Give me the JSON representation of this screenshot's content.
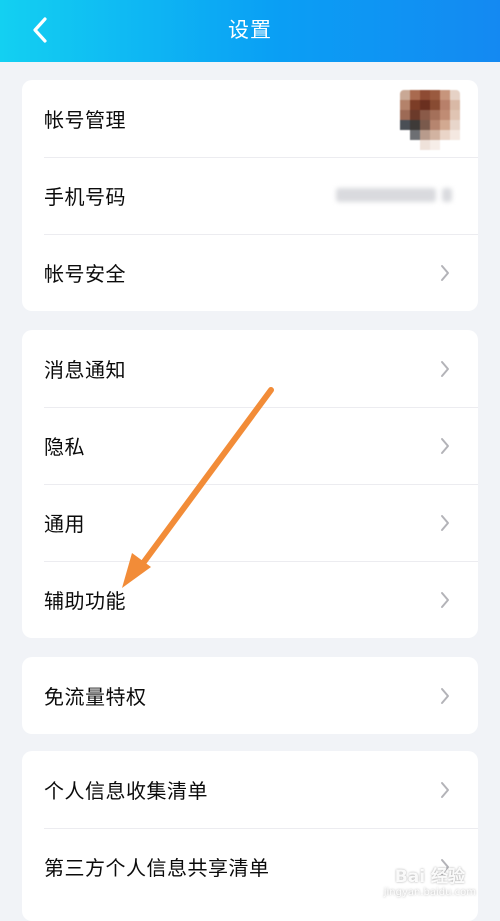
{
  "header": {
    "title": "设置",
    "back_icon": "chevron-left-icon"
  },
  "groups": [
    {
      "items": [
        {
          "label": "帐号管理",
          "accessory": "avatar"
        },
        {
          "label": "手机号码",
          "accessory": "masked-value"
        },
        {
          "label": "帐号安全",
          "accessory": "chevron"
        }
      ]
    },
    {
      "items": [
        {
          "label": "消息通知",
          "accessory": "chevron"
        },
        {
          "label": "隐私",
          "accessory": "chevron"
        },
        {
          "label": "通用",
          "accessory": "chevron"
        },
        {
          "label": "辅助功能",
          "accessory": "chevron"
        }
      ]
    },
    {
      "items": [
        {
          "label": "免流量特权",
          "accessory": "chevron"
        }
      ]
    },
    {
      "items": [
        {
          "label": "个人信息收集清单",
          "accessory": "chevron"
        },
        {
          "label": "第三方个人信息共享清单",
          "accessory": "chevron"
        }
      ]
    }
  ],
  "annotation": {
    "type": "arrow",
    "color": "#f28c38",
    "points_to": "辅助功能"
  },
  "watermark": {
    "main": "Bai 经验",
    "sub": "jingyan.baidu.com"
  },
  "colors": {
    "header_gradient_start": "#13d0f2",
    "header_gradient_end": "#1489f2",
    "background": "#f1f3f7",
    "card": "#ffffff",
    "chevron": "#b3b3b8"
  }
}
